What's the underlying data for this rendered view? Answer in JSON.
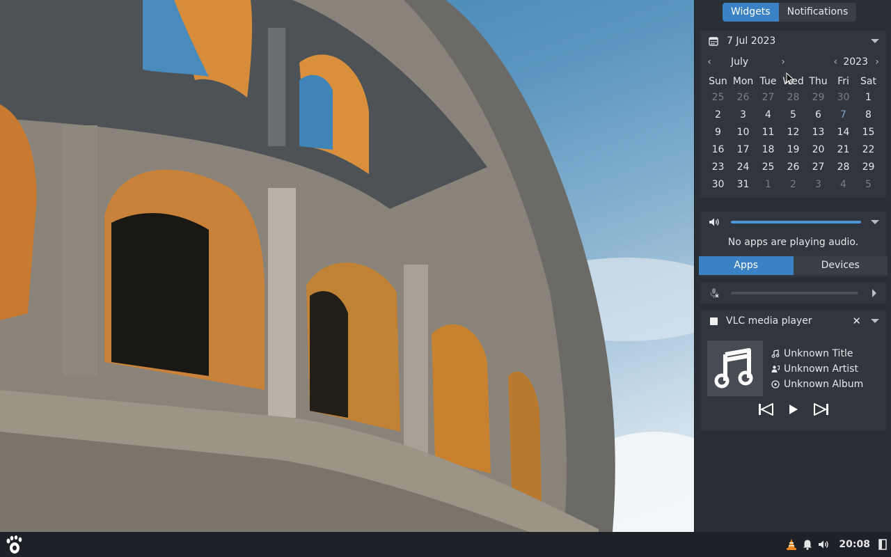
{
  "panel": {
    "tabs": [
      {
        "label": "Widgets",
        "active": true
      },
      {
        "label": "Notifications",
        "active": false
      }
    ],
    "calendar": {
      "date_label": "7 Jul 2023",
      "month": "July",
      "year": "2023",
      "weekdays": [
        "Sun",
        "Mon",
        "Tue",
        "Wed",
        "Thu",
        "Fri",
        "Sat"
      ],
      "weeks": [
        [
          "25",
          "26",
          "27",
          "28",
          "29",
          "30",
          "1"
        ],
        [
          "2",
          "3",
          "4",
          "5",
          "6",
          "7",
          "8"
        ],
        [
          "9",
          "10",
          "11",
          "12",
          "13",
          "14",
          "15"
        ],
        [
          "16",
          "17",
          "18",
          "19",
          "20",
          "21",
          "22"
        ],
        [
          "23",
          "24",
          "25",
          "26",
          "27",
          "28",
          "29"
        ],
        [
          "30",
          "31",
          "1",
          "2",
          "3",
          "4",
          "5"
        ]
      ],
      "today": "7"
    },
    "volume": {
      "level_percent": 100,
      "message": "No apps are playing audio.",
      "tabs": [
        {
          "label": "Apps",
          "active": true
        },
        {
          "label": "Devices",
          "active": false
        }
      ]
    },
    "microphone": {
      "icon": "mic-muted-icon",
      "level_percent": 0
    },
    "media": {
      "player": "VLC media player",
      "title": "Unknown Title",
      "artist": "Unknown Artist",
      "album": "Unknown Album"
    }
  },
  "taskbar": {
    "clock": "20:08"
  },
  "colors": {
    "accent": "#3b82c4",
    "panel_bg": "#2a2e35",
    "card_bg": "#31353d",
    "taskbar_bg": "#1e2127"
  }
}
